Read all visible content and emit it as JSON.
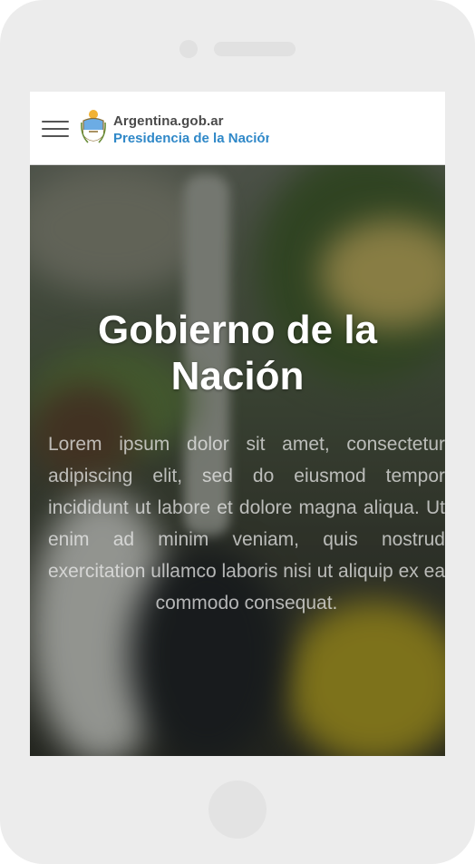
{
  "header": {
    "site_title": "Argentina.gob.ar",
    "subtitle": "Presidencia de la Nación"
  },
  "hero": {
    "title": "Gobierno de la Nación",
    "body": "Lorem ipsum dolor sit amet, consectetur adipiscing elit, sed do eiusmod tempor incididunt ut labore et dolore magna aliqua. Ut enim ad minim veniam, quis nostrud exercitation ullamco laboris nisi ut aliquip ex ea commodo consequat."
  },
  "icons": {
    "menu": "hamburger-menu-icon",
    "logo": "coat-of-arms-icon"
  },
  "colors": {
    "brand_blue": "#2f88c8",
    "brand_gray": "#4a4a4a",
    "device": "#ececec"
  }
}
